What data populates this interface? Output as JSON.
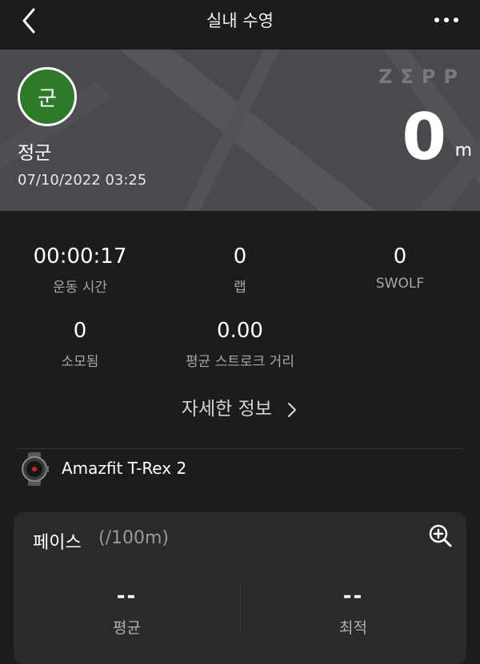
{
  "app_bar": {
    "title": "실내 수영",
    "back_icon": "chevron-left-icon",
    "more_icon": "more-horizontal-icon"
  },
  "hero": {
    "brand": "ZΣPP",
    "avatar_text": "군",
    "user_name": "정군",
    "date": "07/10/2022 03:25",
    "distance_value": "0",
    "distance_unit": "m",
    "avatar_color": "#2f7a2a"
  },
  "stats": [
    {
      "value": "00:00:17",
      "label": "운동 시간"
    },
    {
      "value": "0",
      "label": "랩"
    },
    {
      "value": "0",
      "label": "SWOLF"
    },
    {
      "value": "0",
      "label": "소모됨"
    },
    {
      "value": "0.00",
      "label": "평균 스트로크 거리"
    }
  ],
  "details_link": {
    "label": "자세한 정보",
    "icon": "chevron-right-icon"
  },
  "device": {
    "name": "Amazfit T-Rex 2",
    "icon": "smartwatch-icon"
  },
  "pace_card": {
    "title": "페이스",
    "unit": "(/100m)",
    "zoom_icon": "zoom-in-icon",
    "average": {
      "value": "--",
      "label": "평균"
    },
    "best": {
      "value": "--",
      "label": "최적"
    }
  }
}
